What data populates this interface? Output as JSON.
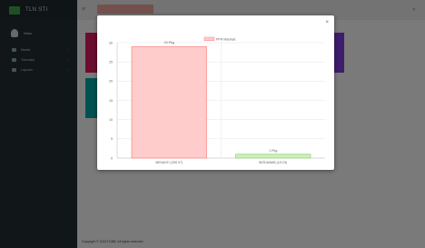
{
  "sidebar": {
    "brand": "TLN STI",
    "user_name": "Nitan",
    "items": [
      {
        "label": "Master",
        "icon": "cogs-icon"
      },
      {
        "label": "Transaksi",
        "icon": "exchange-icon"
      },
      {
        "label": "Laporan",
        "icon": "report-icon"
      }
    ]
  },
  "footer": {
    "prefix": "Copyright © 2023 ",
    "brand": "IT-MS",
    "suffix": ". All rights reserved."
  },
  "modal": {
    "close_label": "×"
  },
  "colors": {
    "bar_1": "#ffcccc",
    "bar_1_border": "#ff8080",
    "bar_2": "#ccf0b8",
    "bar_2_border": "#8ed07a"
  },
  "chart_data": {
    "type": "bar",
    "categories": [
      "MENANTI (29/0.97)",
      "BERJAWAB (1/0.03)"
    ],
    "series": [
      {
        "name": "PPN Manfaat",
        "values": [
          29,
          1
        ]
      }
    ],
    "data_labels": [
      "29 Pkg",
      "1 Pkg"
    ],
    "ylim": [
      0,
      30
    ],
    "yticks": [
      0,
      5,
      10,
      15,
      20,
      25,
      30
    ],
    "grid": true,
    "legend": "top"
  }
}
